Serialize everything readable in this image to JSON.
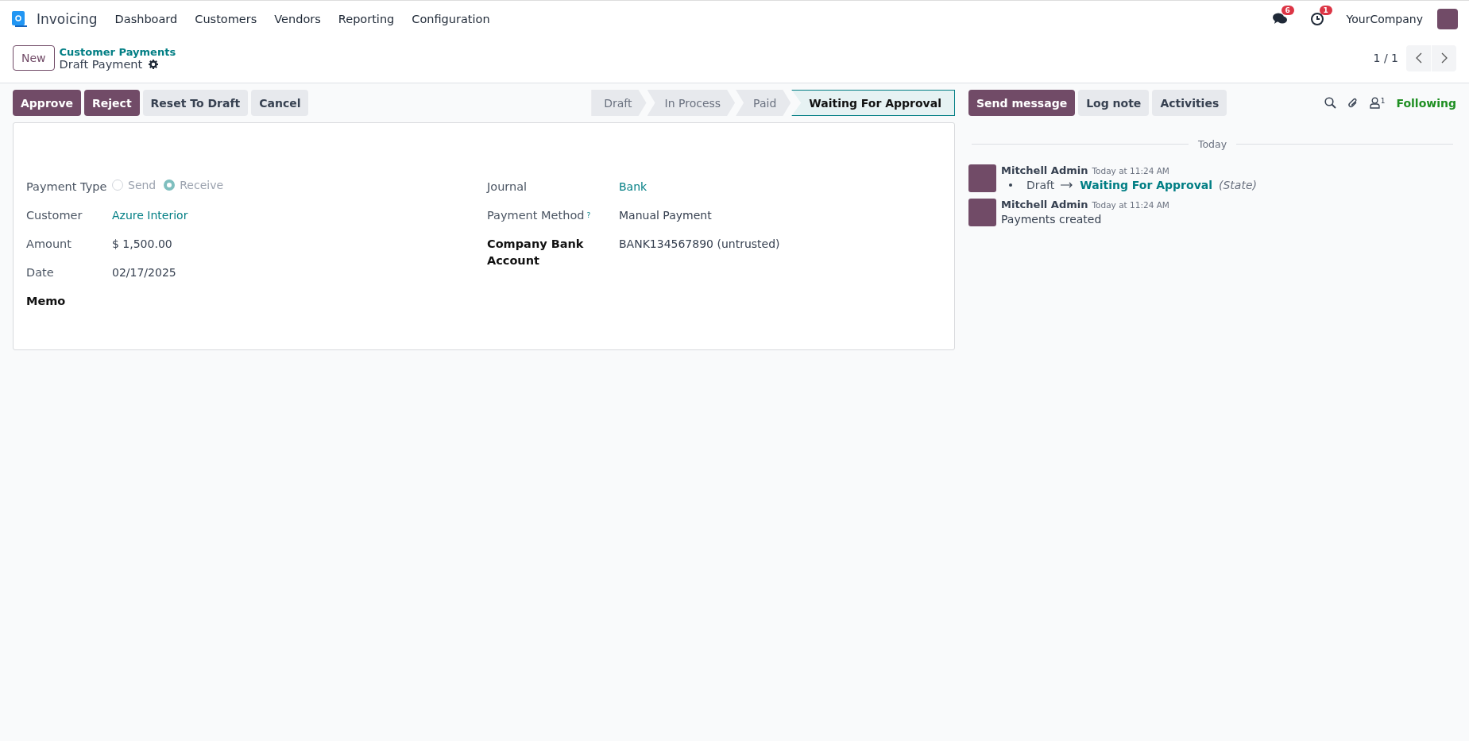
{
  "navbar": {
    "app_name": "Invoicing",
    "menu": [
      "Dashboard",
      "Customers",
      "Vendors",
      "Reporting",
      "Configuration"
    ],
    "messages_badge": "6",
    "activities_badge": "1",
    "company": "YourCompany"
  },
  "breadcrumb": {
    "new_button": "New",
    "parent": "Customer Payments",
    "current": "Draft Payment"
  },
  "pager": {
    "value": "1 / 1"
  },
  "actions": [
    {
      "label": "Approve",
      "primary": true
    },
    {
      "label": "Reject",
      "primary": true
    },
    {
      "label": "Reset To Draft",
      "primary": false
    },
    {
      "label": "Cancel",
      "primary": false
    }
  ],
  "status_bar": [
    {
      "label": "Draft",
      "selected": false
    },
    {
      "label": "In Process",
      "selected": false
    },
    {
      "label": "Paid",
      "selected": false
    },
    {
      "label": "Waiting For Approval",
      "selected": true
    }
  ],
  "form": {
    "left": [
      {
        "kind": "radio",
        "label": "Payment Type",
        "required": false,
        "options": [
          {
            "label": "Send",
            "selected": false
          },
          {
            "label": "Receive",
            "selected": true
          }
        ]
      },
      {
        "kind": "link",
        "label": "Customer",
        "required": false,
        "value": "Azure Interior"
      },
      {
        "kind": "text",
        "label": "Amount",
        "required": false,
        "value": "$ 1,500.00"
      },
      {
        "kind": "text",
        "label": "Date",
        "required": false,
        "value": "02/17/2025"
      },
      {
        "kind": "empty",
        "label": "Memo",
        "required": true
      }
    ],
    "right": [
      {
        "kind": "link",
        "label": "Journal",
        "required": false,
        "value": "Bank"
      },
      {
        "kind": "text",
        "label": "Payment Method",
        "required": false,
        "help": "?",
        "value": "Manual Payment"
      },
      {
        "kind": "text",
        "label": "Company Bank Account",
        "required": true,
        "value": "BANK134567890 (untrusted)"
      }
    ]
  },
  "chatter": {
    "buttons": [
      {
        "label": "Send message",
        "primary": true
      },
      {
        "label": "Log note",
        "primary": false
      },
      {
        "label": "Activities",
        "primary": false
      }
    ],
    "followers_count": "1",
    "follow_label": "Following",
    "divider": "Today",
    "messages": [
      {
        "kind": "tracking",
        "author": "Mitchell Admin",
        "time": "Today at 11:24 AM",
        "old_value": "Draft",
        "new_value": "Waiting For Approval",
        "field": "(State)"
      },
      {
        "kind": "text",
        "author": "Mitchell Admin",
        "time": "Today at 11:24 AM",
        "body": "Payments created"
      }
    ]
  }
}
